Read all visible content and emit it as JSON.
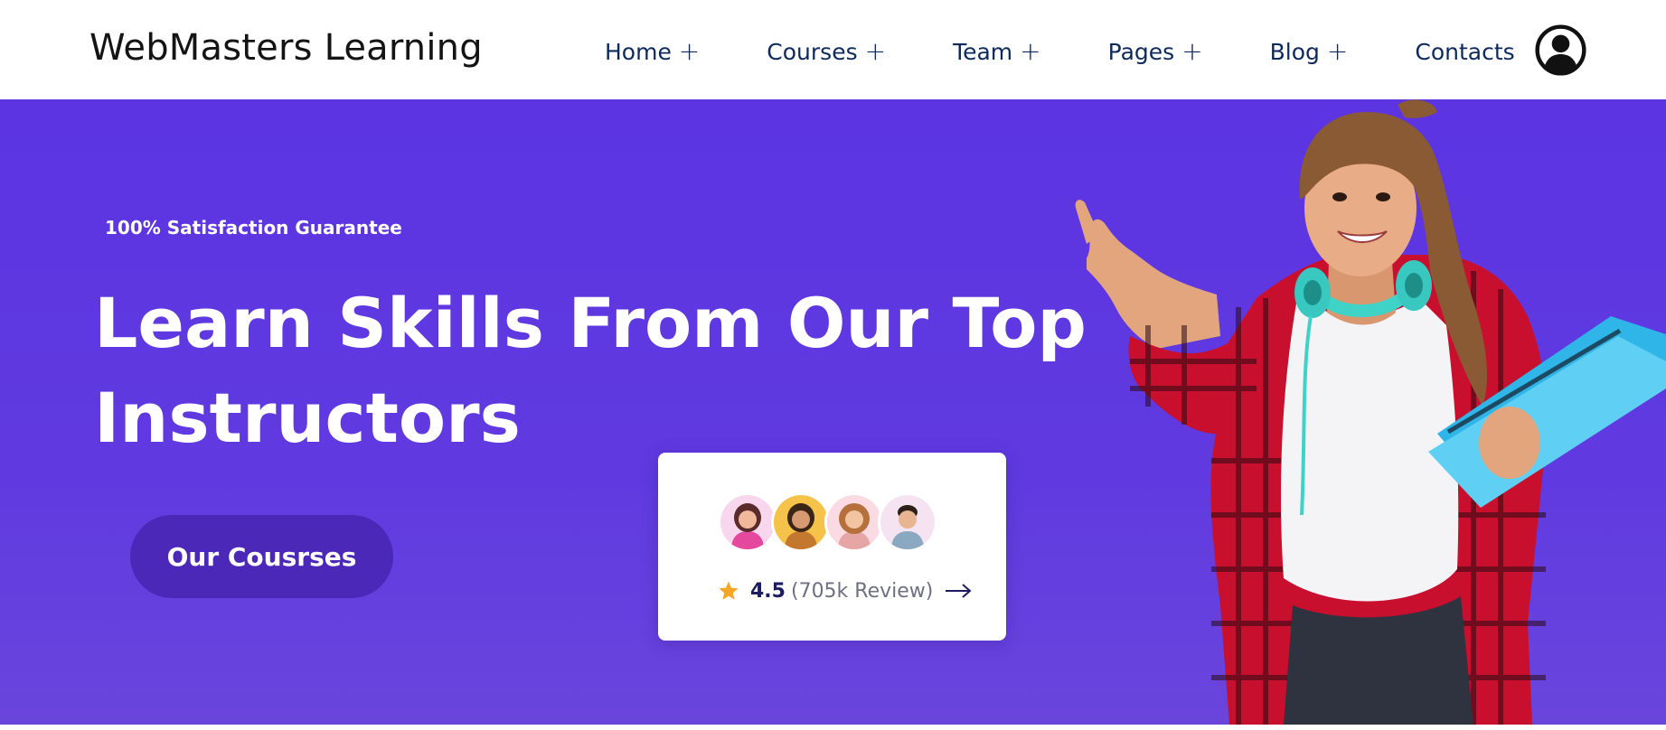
{
  "header": {
    "brand": "WebMasters Learning",
    "nav": [
      {
        "label": "Home",
        "has_submenu": true
      },
      {
        "label": "Courses",
        "has_submenu": true
      },
      {
        "label": "Team",
        "has_submenu": true
      },
      {
        "label": "Pages",
        "has_submenu": true
      },
      {
        "label": "Blog",
        "has_submenu": true
      },
      {
        "label": "Contacts",
        "has_submenu": false
      }
    ],
    "submenu_symbol": "+",
    "user_icon": "user-circle-icon"
  },
  "hero": {
    "eyebrow": "100% Satisfaction Guarantee",
    "headline_line1": "Learn Skills From Our Top",
    "headline_line2": "Instructors",
    "cta_label": "Our Cousrses",
    "review_card": {
      "rating": "4.5",
      "review_count": "(705k Review)",
      "star_icon": "star-icon",
      "arrow_icon": "arrow-right-icon"
    }
  },
  "colors": {
    "hero_bg": "#5c34e2",
    "cta_bg": "#4b28b8",
    "nav_text": "#0e2a5c",
    "star": "#f5a623",
    "rating_text": "#1d1c61"
  }
}
